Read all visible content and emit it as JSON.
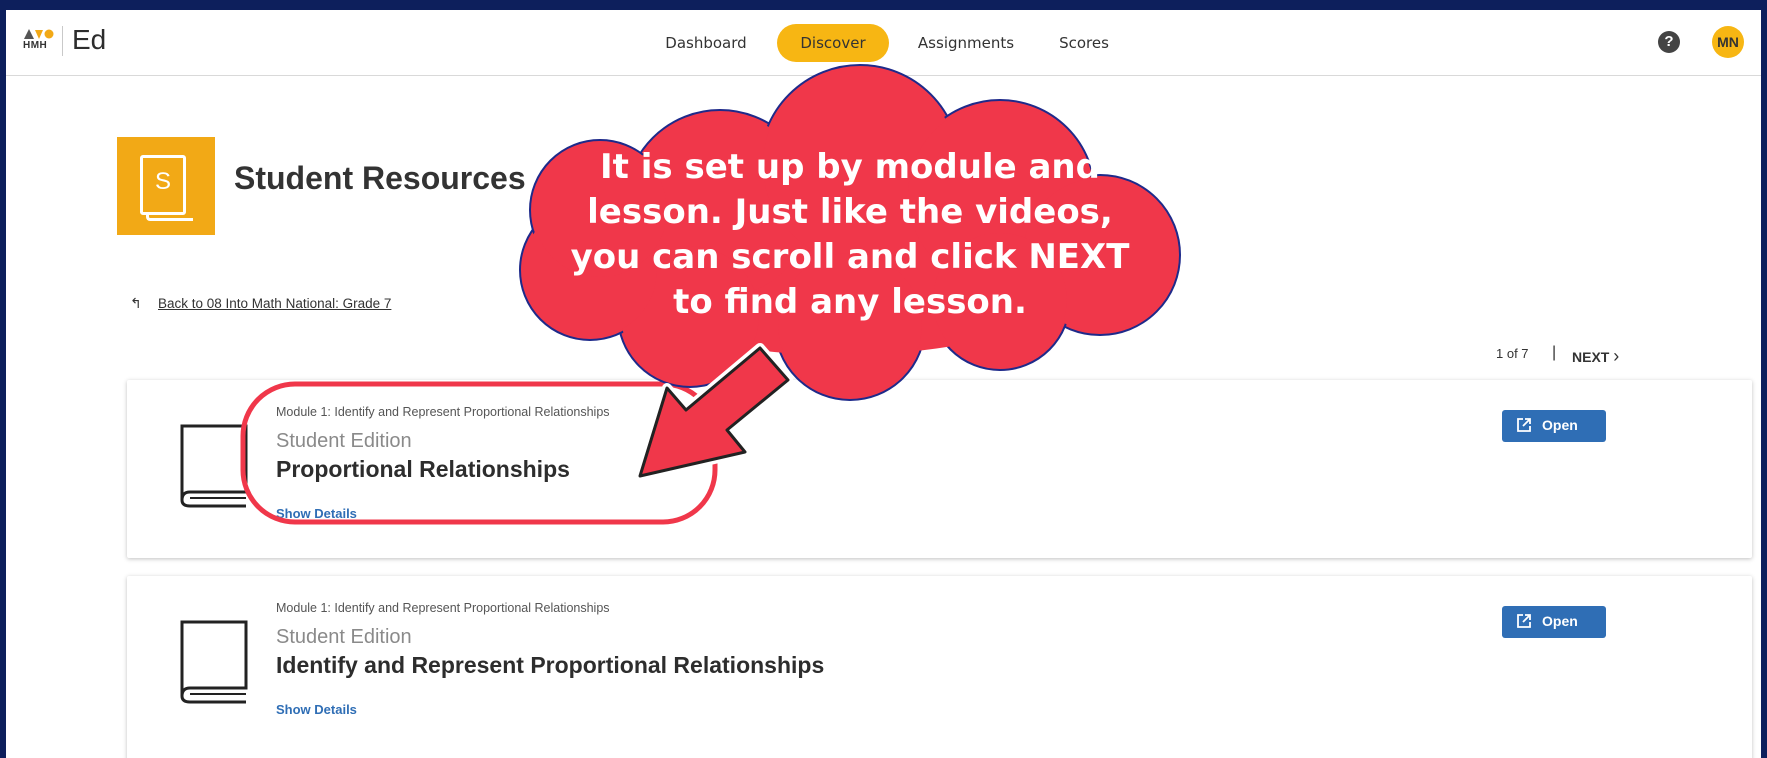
{
  "brand": {
    "hmh_label": "HMH",
    "app_name": "Ed"
  },
  "nav": {
    "items": [
      {
        "label": "Dashboard",
        "active": false
      },
      {
        "label": "Discover",
        "active": true
      },
      {
        "label": "Assignments",
        "active": false
      },
      {
        "label": "Scores",
        "active": false
      }
    ],
    "help_icon": "question-icon",
    "avatar_initials": "MN"
  },
  "header": {
    "icon_letter": "S",
    "title": "Student Resources",
    "back_link": "Back to 08 Into Math National: Grade 7"
  },
  "pager": {
    "position": "1 of 7",
    "next_label": "NEXT"
  },
  "cards": [
    {
      "module": "Module 1: Identify and Represent Proportional Relationships",
      "edition": "Student Edition",
      "lesson": "Proportional Relationships",
      "details": "Show Details",
      "open_label": "Open"
    },
    {
      "module": "Module 1: Identify and Represent Proportional Relationships",
      "edition": "Student Edition",
      "lesson": "Identify and Represent Proportional Relationships",
      "details": "Show Details",
      "open_label": "Open"
    }
  ],
  "callout": {
    "text": "It is set up by module and lesson. Just like the videos, you can scroll and click NEXT to find any lesson."
  },
  "colors": {
    "accent_yellow": "#f7b613",
    "link_blue": "#2f6eb5",
    "callout_red": "#f0374a",
    "frame_navy": "#0d1f5c"
  }
}
